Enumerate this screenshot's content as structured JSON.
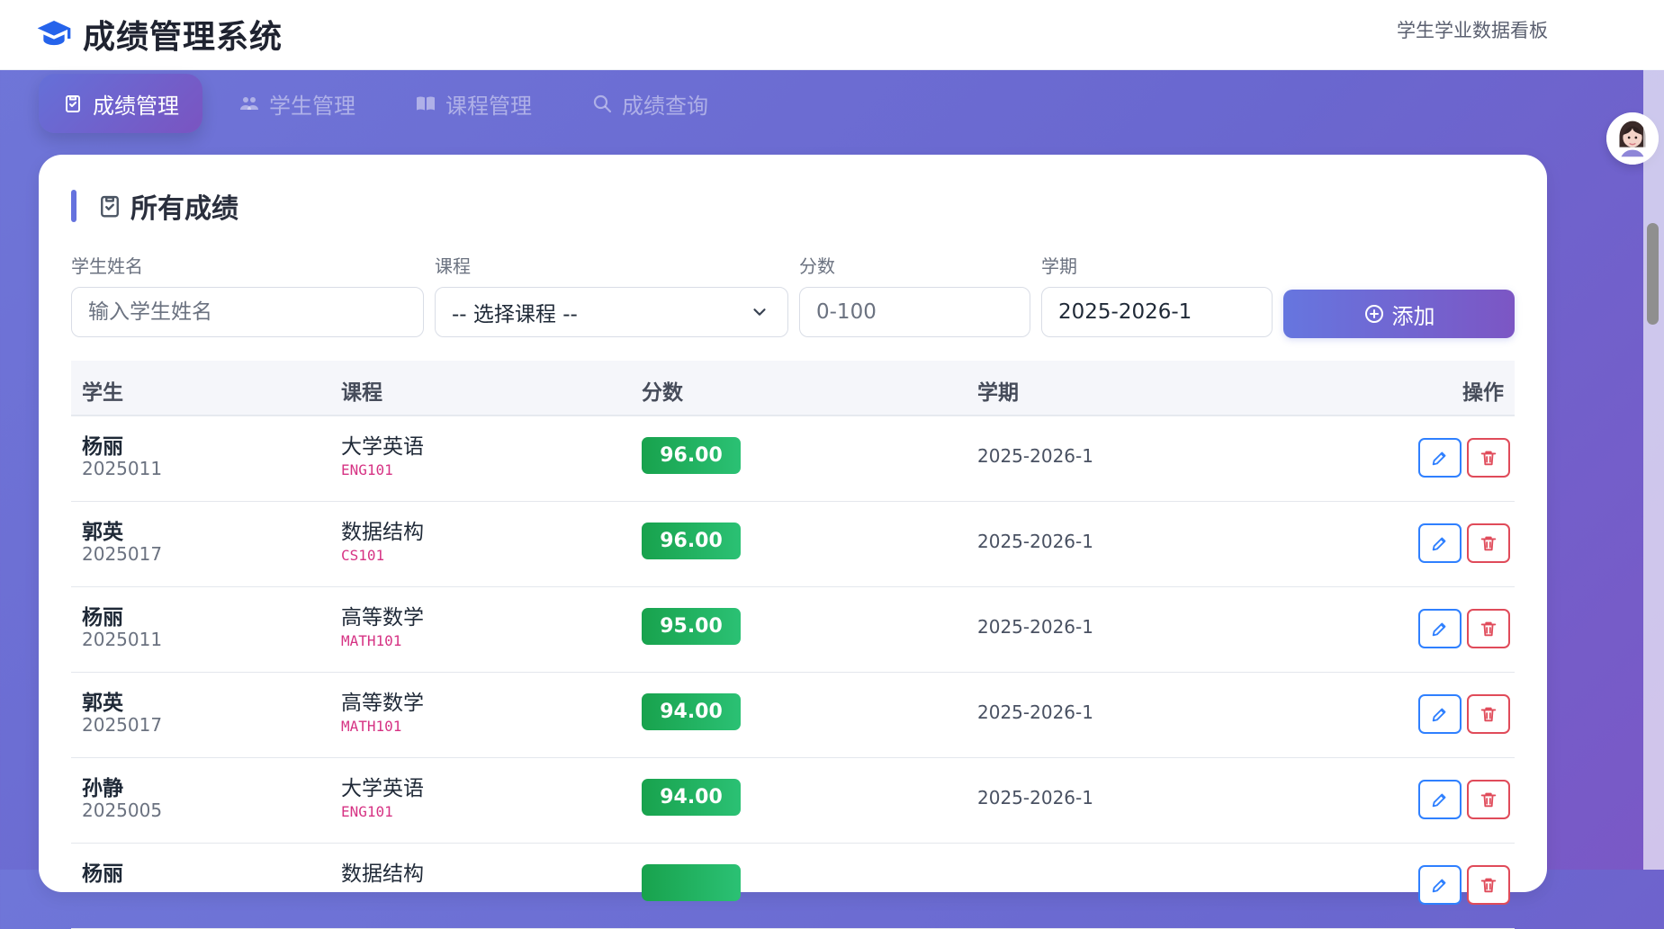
{
  "header": {
    "app_title": "成绩管理系统",
    "dashboard_link": "学生学业数据看板"
  },
  "nav": {
    "tabs": [
      {
        "label": "成绩管理",
        "icon": "clipboard-check-icon",
        "active": true
      },
      {
        "label": "学生管理",
        "icon": "users-icon",
        "active": false
      },
      {
        "label": "课程管理",
        "icon": "book-open-icon",
        "active": false
      },
      {
        "label": "成绩查询",
        "icon": "search-icon",
        "active": false
      }
    ]
  },
  "section": {
    "title": "所有成绩"
  },
  "form": {
    "student_name_label": "学生姓名",
    "student_name_placeholder": "输入学生姓名",
    "course_label": "课程",
    "course_selected": "-- 选择课程 --",
    "score_label": "分数",
    "score_placeholder": "0-100",
    "term_label": "学期",
    "term_value": "2025-2026-1",
    "add_button_label": "添加"
  },
  "table": {
    "headers": {
      "student": "学生",
      "course": "课程",
      "score": "分数",
      "term": "学期",
      "actions": "操作"
    },
    "rows": [
      {
        "name": "杨丽",
        "student_id": "2025011",
        "course_name": "大学英语",
        "course_code": "ENG101",
        "score": "96.00",
        "term": "2025-2026-1"
      },
      {
        "name": "郭英",
        "student_id": "2025017",
        "course_name": "数据结构",
        "course_code": "CS101",
        "score": "96.00",
        "term": "2025-2026-1"
      },
      {
        "name": "杨丽",
        "student_id": "2025011",
        "course_name": "高等数学",
        "course_code": "MATH101",
        "score": "95.00",
        "term": "2025-2026-1"
      },
      {
        "name": "郭英",
        "student_id": "2025017",
        "course_name": "高等数学",
        "course_code": "MATH101",
        "score": "94.00",
        "term": "2025-2026-1"
      },
      {
        "name": "孙静",
        "student_id": "2025005",
        "course_name": "大学英语",
        "course_code": "ENG101",
        "score": "94.00",
        "term": "2025-2026-1"
      },
      {
        "name": "杨丽",
        "student_id": "",
        "course_name": "数据结构",
        "course_code": "",
        "score": "",
        "term": ""
      }
    ]
  },
  "colors": {
    "accent": "#6572de",
    "score_badge": "#18a24d",
    "edit_outline": "#2f80ff",
    "delete_outline": "#e04b5a",
    "course_code": "#d63384"
  }
}
